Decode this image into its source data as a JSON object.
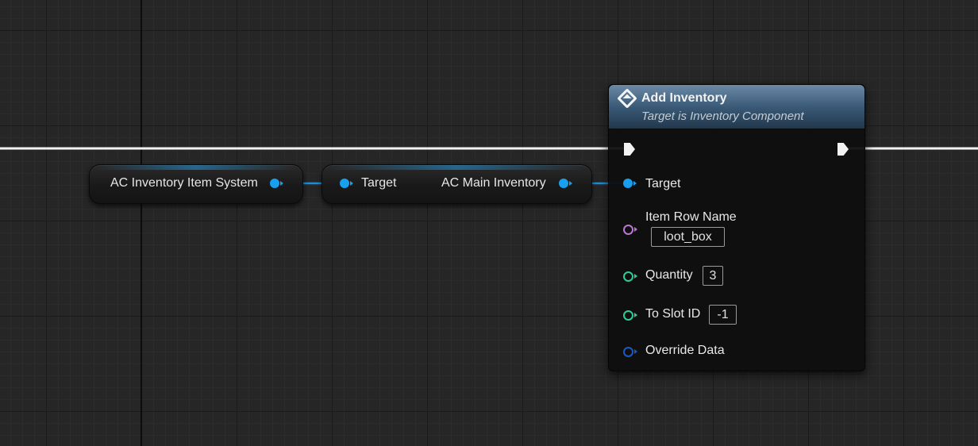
{
  "nodes": {
    "self_getter": {
      "label": "AC Inventory Item System"
    },
    "member_getter": {
      "input_label": "Target",
      "output_label": "AC Main Inventory"
    },
    "function_call": {
      "title": "Add Inventory",
      "subtitle": "Target is Inventory Component",
      "pins": {
        "target": "Target",
        "item_row_name": "Item Row Name",
        "quantity": "Quantity",
        "to_slot_id": "To Slot ID",
        "override_data": "Override Data"
      },
      "values": {
        "item_row_name": "loot_box",
        "quantity": "3",
        "to_slot_id": "-1"
      }
    }
  },
  "colors": {
    "object_pin": "#16a0ee",
    "name_pin": "#b878d6",
    "integer_pin": "#2fcc98",
    "struct_pin": "#1b58c4",
    "exec_wire": "#f2f2f2",
    "function_header": "#3a5a78"
  },
  "icons": {
    "function": "function-icon",
    "exec": "exec-arrow-icon"
  }
}
